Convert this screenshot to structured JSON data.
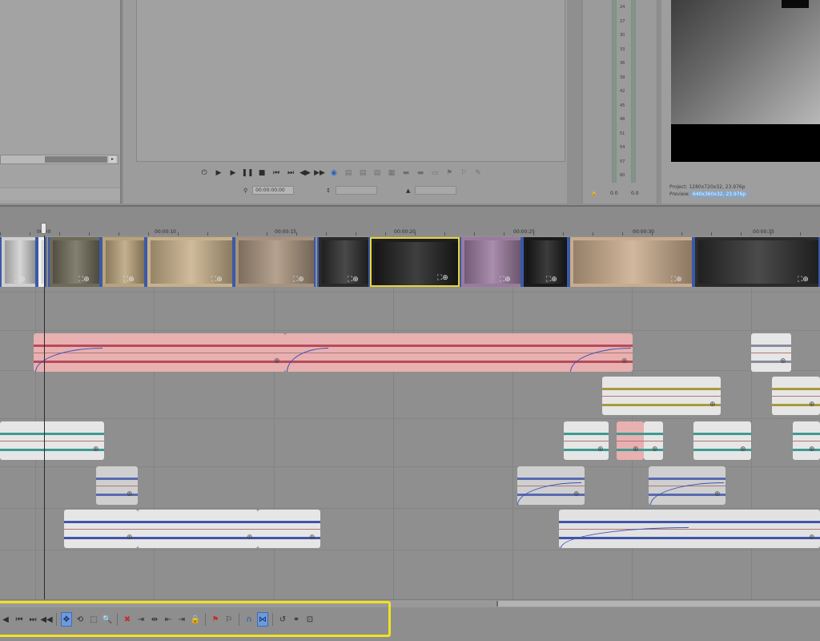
{
  "preview": {
    "timecode": "00:00:00;00"
  },
  "meter": {
    "ticks": [
      "24",
      "27",
      "30",
      "33",
      "36",
      "39",
      "42",
      "45",
      "48",
      "51",
      "54",
      "57",
      "60"
    ],
    "left_label": "0.0",
    "right_label": "0.0"
  },
  "video_preview": {
    "project_label": "Project:",
    "project_value": "1280x720x32, 23.976p",
    "preview_label": "Preview:",
    "preview_value": "640x360x32, 23.976p"
  },
  "ruler": {
    "marks": [
      "00:00",
      "00:00:10",
      "00:00:15",
      "00:00:20",
      "00:00:25",
      "00:00:30",
      "00:00:35"
    ]
  },
  "toolbar": {
    "items": [
      {
        "name": "prev-frame-icon",
        "glyph": "◀"
      },
      {
        "name": "go-start-icon",
        "glyph": "⏮"
      },
      {
        "name": "go-end-icon",
        "glyph": "⏭"
      },
      {
        "name": "rewind-icon",
        "glyph": "◀◀"
      },
      {
        "name": "normal-edit-tool-icon",
        "glyph": "✥"
      },
      {
        "name": "envelope-tool-icon",
        "glyph": "⟲"
      },
      {
        "name": "selection-tool-icon",
        "glyph": "⬚"
      },
      {
        "name": "zoom-tool-icon",
        "glyph": "🔍"
      },
      {
        "name": "delete-icon",
        "glyph": "✖"
      },
      {
        "name": "trim-icon",
        "glyph": "⇥"
      },
      {
        "name": "split-icon",
        "glyph": "⇹"
      },
      {
        "name": "trim-start-icon",
        "glyph": "⇤"
      },
      {
        "name": "trim-end-icon",
        "glyph": "⇥"
      },
      {
        "name": "lock-icon",
        "glyph": "🔒"
      },
      {
        "name": "marker-icon",
        "glyph": "⚑"
      },
      {
        "name": "region-icon",
        "glyph": "⚐"
      },
      {
        "name": "snap-icon",
        "glyph": "∩"
      },
      {
        "name": "auto-crossfade-icon",
        "glyph": "⋈"
      },
      {
        "name": "auto-ripple-icon",
        "glyph": "↺"
      },
      {
        "name": "group-icon",
        "glyph": "⚭"
      },
      {
        "name": "ignore-grouping-icon",
        "glyph": "⊡"
      }
    ]
  }
}
